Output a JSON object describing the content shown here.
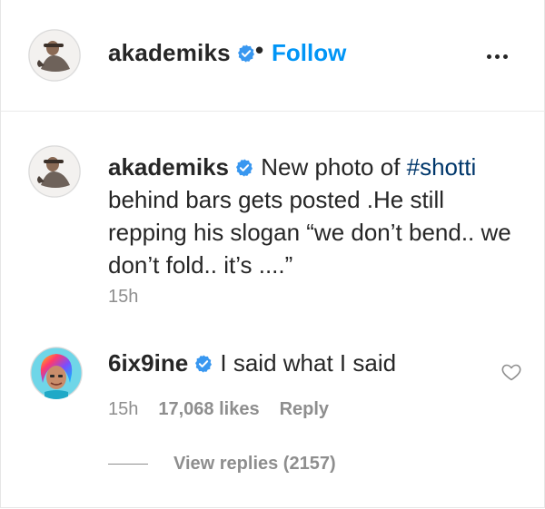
{
  "post_header": {
    "username": "akademiks",
    "separator": "•",
    "follow_label": "Follow"
  },
  "caption": {
    "username": "akademiks",
    "text_before": " New photo of ",
    "hashtag": "#shotti",
    "text_after": " behind bars gets posted .He still repping his slogan “we don’t bend.. we don’t fold.. it’s ....”",
    "time": "15h"
  },
  "comment": {
    "username": "6ix9ine",
    "text": " I said what I said",
    "time": "15h",
    "likes": "17,068 likes",
    "reply_label": "Reply",
    "view_replies": "View replies (2157)"
  },
  "icons": {
    "verified": "verified-badge-icon",
    "more": "more-options-icon",
    "heart": "heart-icon"
  },
  "colors": {
    "accent": "#0095f6",
    "verified": "#3897f0",
    "hashtag": "#00376b",
    "secondary": "#8e8e8e",
    "text": "#262626"
  }
}
